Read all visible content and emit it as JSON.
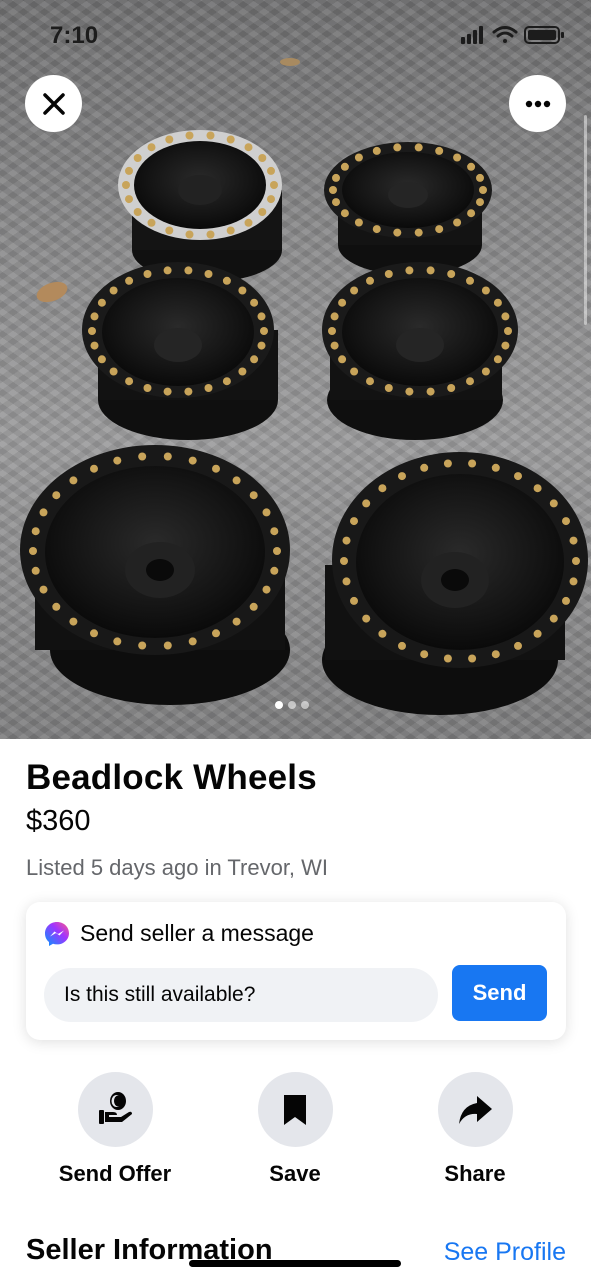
{
  "status_bar": {
    "time": "7:10"
  },
  "photo": {
    "image_index": 1,
    "image_count": 3
  },
  "listing": {
    "title": "Beadlock Wheels",
    "price": "$360",
    "listed": "Listed 5 days ago in Trevor, WI"
  },
  "message_card": {
    "header": "Send seller a message",
    "input_value": "Is this still available?",
    "send_label": "Send"
  },
  "actions": [
    {
      "label": "Send Offer",
      "icon": "send-offer-icon"
    },
    {
      "label": "Save",
      "icon": "bookmark-icon"
    },
    {
      "label": "Share",
      "icon": "share-arrow-icon"
    }
  ],
  "seller": {
    "heading": "Seller Information",
    "see_profile": "See Profile"
  },
  "colors": {
    "accent": "#1877f2",
    "secondary_text": "#65676b",
    "action_bg": "#e4e6eb",
    "input_bg": "#f0f2f5"
  }
}
